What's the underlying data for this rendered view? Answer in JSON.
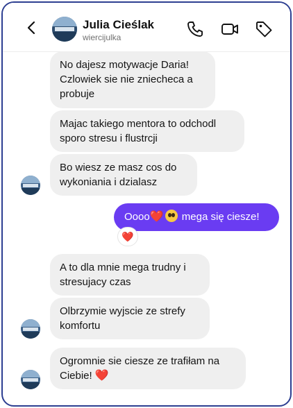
{
  "header": {
    "name": "Julia Cieślak",
    "username": "wiercijulka",
    "icons": [
      "back-arrow-icon",
      "phone-icon",
      "video-camera-icon",
      "tag-icon"
    ]
  },
  "messages": [
    {
      "direction": "in",
      "text": "No dajesz motywacje Daria! Czlowiek sie nie zniecheca a probuje"
    },
    {
      "direction": "in",
      "text": "Majac takiego mentora to odchodl sporo stresu i flustrcji"
    },
    {
      "direction": "in",
      "text": "Bo wiesz ze masz cos do wykoniania i dzialasz"
    },
    {
      "direction": "out",
      "text_before": "Oooo",
      "emoji_heart": "❤️",
      "text_after": " mega się ciesze!",
      "reaction": "❤️"
    },
    {
      "direction": "in",
      "text": "A to dla mnie mega trudny i stresujacy czas"
    },
    {
      "direction": "in",
      "text": "Olbrzymie wyjscie ze strefy komfortu"
    },
    {
      "direction": "in",
      "text": "Ogromnie sie ciesze ze trafiłam na Ciebie!",
      "emoji_heart": "❤️"
    }
  ],
  "colors": {
    "outgoing_bubble": "#6a3cf2",
    "incoming_bubble": "#efefef",
    "frame_border": "#2c3e91"
  }
}
